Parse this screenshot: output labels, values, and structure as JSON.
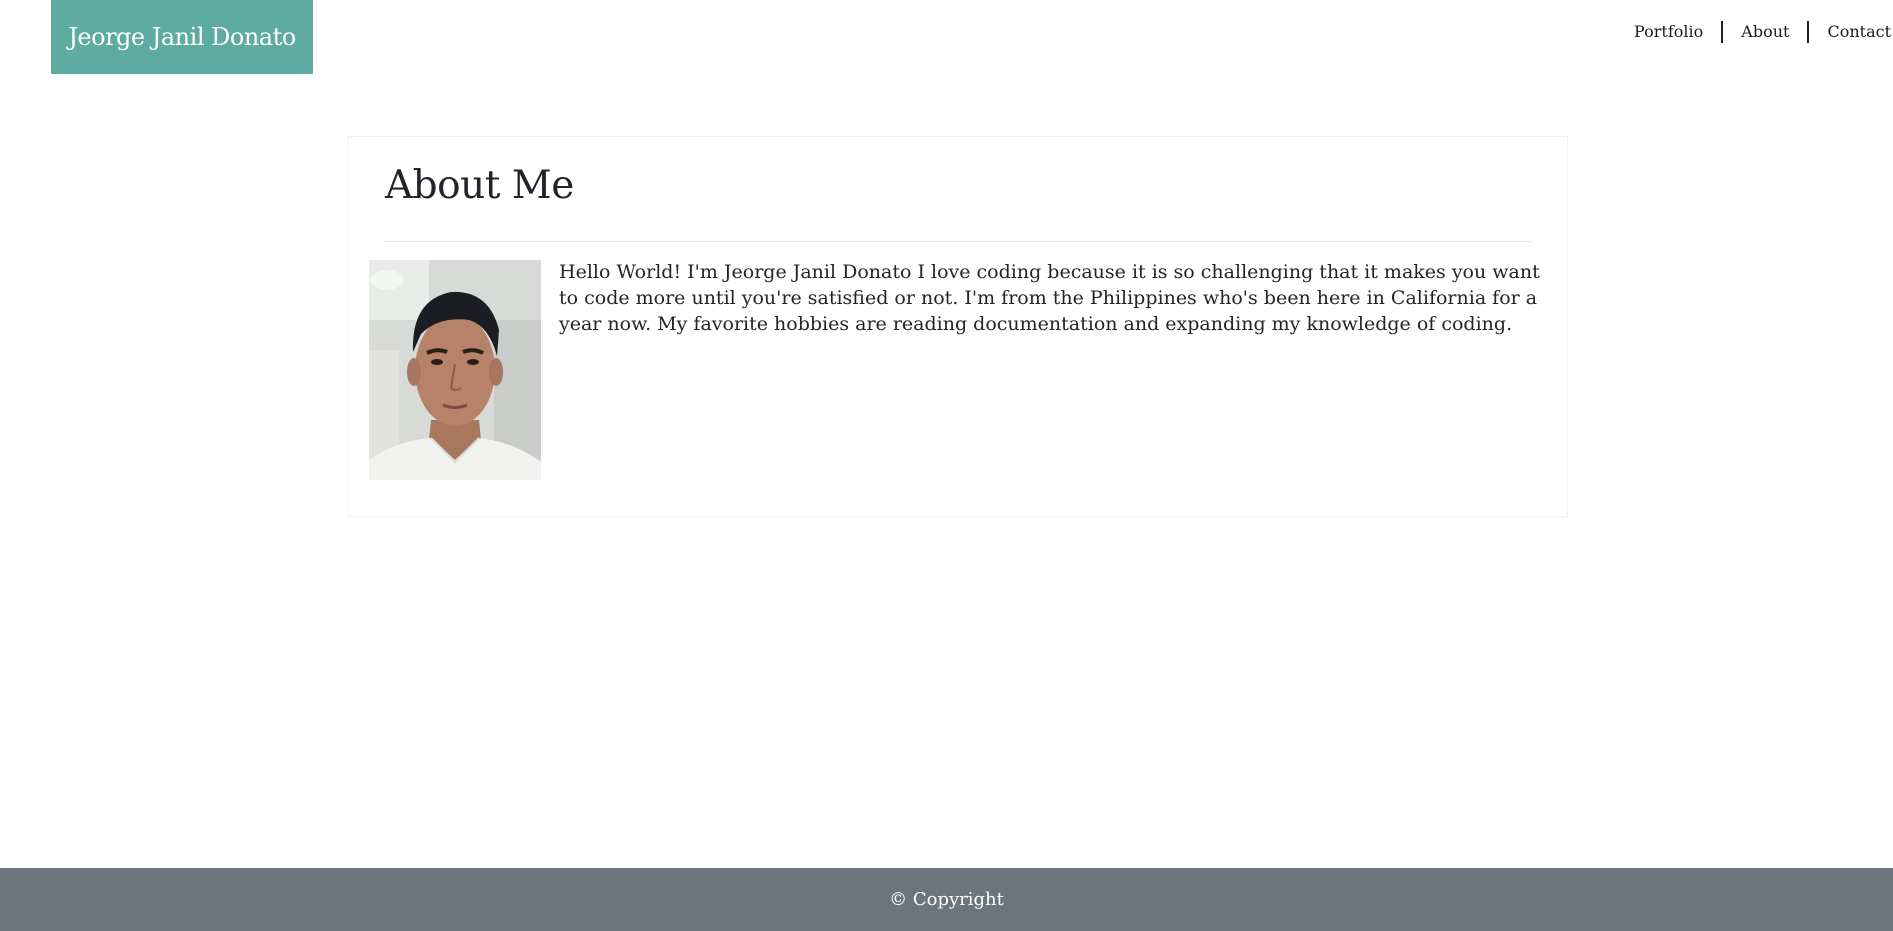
{
  "header": {
    "brand": "Jeorge Janil Donato",
    "nav": {
      "portfolio": "Portfolio",
      "about": "About",
      "contact": "Contact"
    }
  },
  "about": {
    "title": "About Me",
    "photo_alt": "profile-photo",
    "bio": "Hello World! I'm Jeorge Janil Donato I love coding because it is so challenging that it makes you want to code more until you're satisfied or not. I'm from the Philippines who's been here in California for a year now. My favorite hobbies are reading documentation and expanding my knowledge of coding."
  },
  "footer": {
    "copyright": "© Copyright"
  },
  "colors": {
    "brand_bg": "#5eaba2",
    "footer_bg": "#6c757d"
  }
}
